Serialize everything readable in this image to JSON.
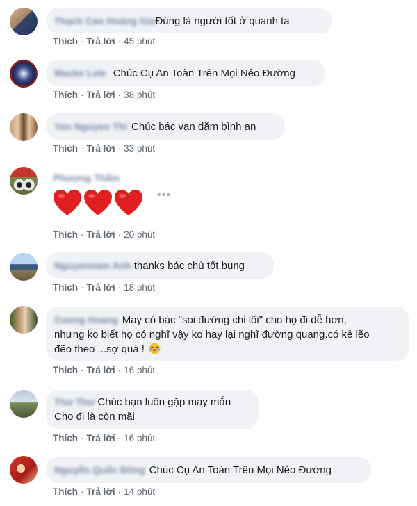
{
  "comments": [
    {
      "name": "Thạch Cao Hoàng Gia",
      "text": "Đúng là người tốt ở quanh ta",
      "like": "Thích",
      "reply": "Trả lời",
      "time": "45 phút",
      "avatar_colors": [
        "#c9a68c",
        "#3a4a6b"
      ]
    },
    {
      "name": "Macke Lele",
      "text": "Chúc Cụ An Toàn Trên Mọi Nẻo Đường",
      "like": "Thích",
      "reply": "Trả lời",
      "time": "38 phút",
      "avatar_colors": [
        "#1f2d5c",
        "#c0392b"
      ]
    },
    {
      "name": "Yen Nguyen Thi",
      "text": "Chúc bác vạn dặm bình an",
      "like": "Thích",
      "reply": "Trả lời",
      "time": "33 phút",
      "avatar_colors": [
        "#d9b48f",
        "#7b5e45"
      ]
    },
    {
      "name": "Phượng Thẩm",
      "text": "",
      "like": "Thích",
      "reply": "Trả lời",
      "time": "20 phút",
      "avatar_colors": [
        "#c0392b",
        "#556b2f"
      ],
      "reaction": "heart-icons",
      "heart_color": "#e02020"
    },
    {
      "name": "Nguyennam Anh",
      "text": "thanks bác chủ tốt bụng",
      "like": "Thích",
      "reply": "Trả lời",
      "time": "18 phút",
      "avatar_colors": [
        "#87a9c8",
        "#445566"
      ]
    },
    {
      "name": "Cuong Hoang",
      "text_lines": [
        "May có bác \"soi đường chỉ lối\" cho họ đi dễ hơn,",
        "nhưng ko biết họ có nghĩ vậy ko hay lại nghĩ đường quang.có kẻ lẽo",
        "đẽo theo ...sợ quá !"
      ],
      "emoji": "laughing-emoji-icon",
      "like": "Thích",
      "reply": "Trả lời",
      "time": "16 phút",
      "avatar_colors": [
        "#5a6b3a",
        "#c49a7a"
      ]
    },
    {
      "name": "Thư Thư",
      "text_lines": [
        "Chúc bạn luôn gặp may mắn",
        "Cho đi là còn mãi"
      ],
      "like": "Thích",
      "reply": "Trả lời",
      "time": "16 phút",
      "avatar_colors": [
        "#9fb3c8",
        "#6a7a5a"
      ]
    },
    {
      "name": "Nguyễn Quốc Đông",
      "text": "Chúc Cụ An Toàn Trên Mọi Nẻo Đường",
      "like": "Thích",
      "reply": "Trả lời",
      "time": "14 phút",
      "avatar_colors": [
        "#c62828",
        "#f0d0a0"
      ]
    }
  ]
}
